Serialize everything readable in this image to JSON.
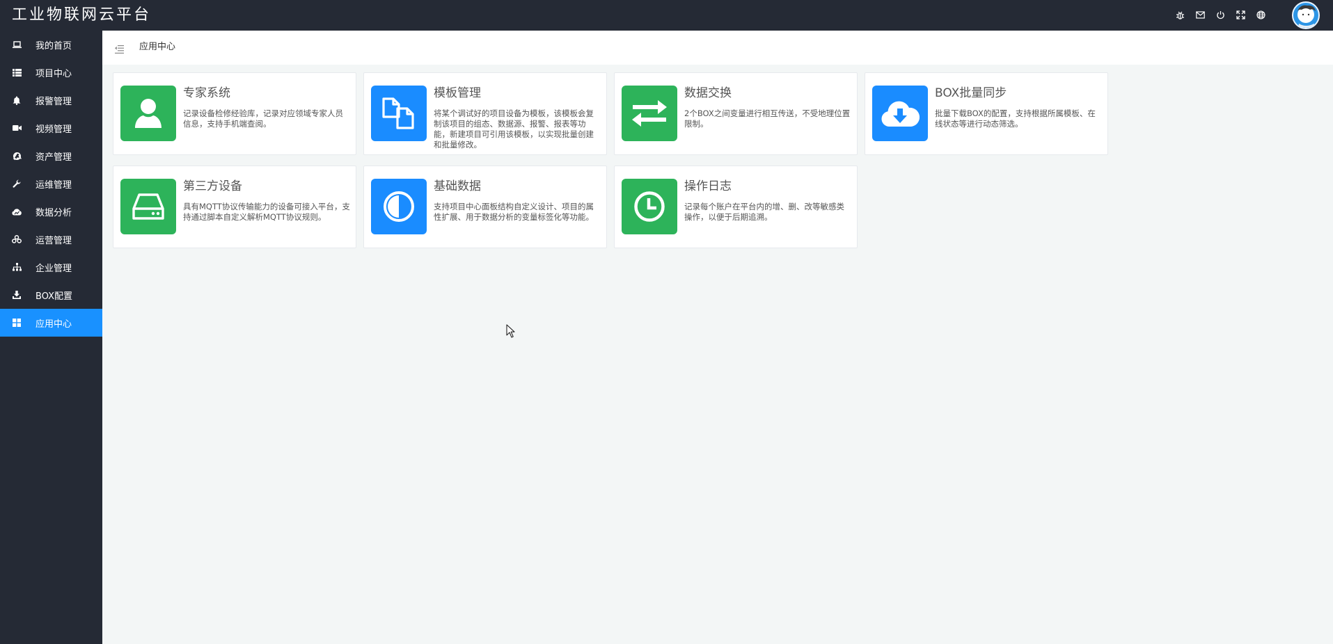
{
  "app": {
    "title": "工业物联网云平台"
  },
  "colors": {
    "topbar": "#252a35",
    "sidebar": "#252a35",
    "active": "#1991ff",
    "green": "#2db35a",
    "blue": "#1a8cff"
  },
  "top_icons": [
    "bug-icon",
    "mail-icon",
    "power-icon",
    "fullscreen-icon",
    "globe-icon"
  ],
  "sidebar": {
    "items": [
      {
        "label": "我的首页",
        "icon": "laptop-icon"
      },
      {
        "label": "项目中心",
        "icon": "list-icon"
      },
      {
        "label": "报警管理",
        "icon": "bell-icon"
      },
      {
        "label": "视频管理",
        "icon": "video-icon"
      },
      {
        "label": "资产管理",
        "icon": "recycle-icon"
      },
      {
        "label": "运维管理",
        "icon": "wrench-icon"
      },
      {
        "label": "数据分析",
        "icon": "chart-icon"
      },
      {
        "label": "运营管理",
        "icon": "cubes-icon"
      },
      {
        "label": "企业管理",
        "icon": "sitemap-icon"
      },
      {
        "label": "BOX配置",
        "icon": "download-icon"
      },
      {
        "label": "应用中心",
        "icon": "grid-icon",
        "active": true
      }
    ]
  },
  "header": {
    "breadcrumb": "应用中心"
  },
  "cards": [
    {
      "title": "专家系统",
      "desc": "记录设备检修经验库，记录对应领域专家人员信息，支持手机端查阅。",
      "icon": "user-icon",
      "color": "green"
    },
    {
      "title": "模板管理",
      "desc": "将某个调试好的项目设备为模板，该模板会复制该项目的组态、数据源、报警、报表等功能，新建项目可引用该模板，以实现批量创建和批量修改。",
      "icon": "copy-icon",
      "color": "blue"
    },
    {
      "title": "数据交换",
      "desc": "2个BOX之间变量进行相互传送，不受地理位置限制。",
      "icon": "exchange-icon",
      "color": "green"
    },
    {
      "title": "BOX批量同步",
      "desc": "批量下载BOX的配置，支持根据所属模板、在线状态等进行动态筛选。",
      "icon": "cloud-download-icon",
      "color": "blue"
    },
    {
      "title": "第三方设备",
      "desc": "具有MQTT协议传输能力的设备可接入平台，支持通过脚本自定义解析MQTT协议规则。",
      "icon": "hdd-icon",
      "color": "green"
    },
    {
      "title": "基础数据",
      "desc": "支持项目中心面板结构自定义设计、项目的属性扩展、用于数据分析的变量标签化等功能。",
      "icon": "adjust-icon",
      "color": "blue"
    },
    {
      "title": "操作日志",
      "desc": "记录每个账户在平台内的增、删、改等敏感类操作，以便于后期追溯。",
      "icon": "clock-icon",
      "color": "green"
    }
  ]
}
